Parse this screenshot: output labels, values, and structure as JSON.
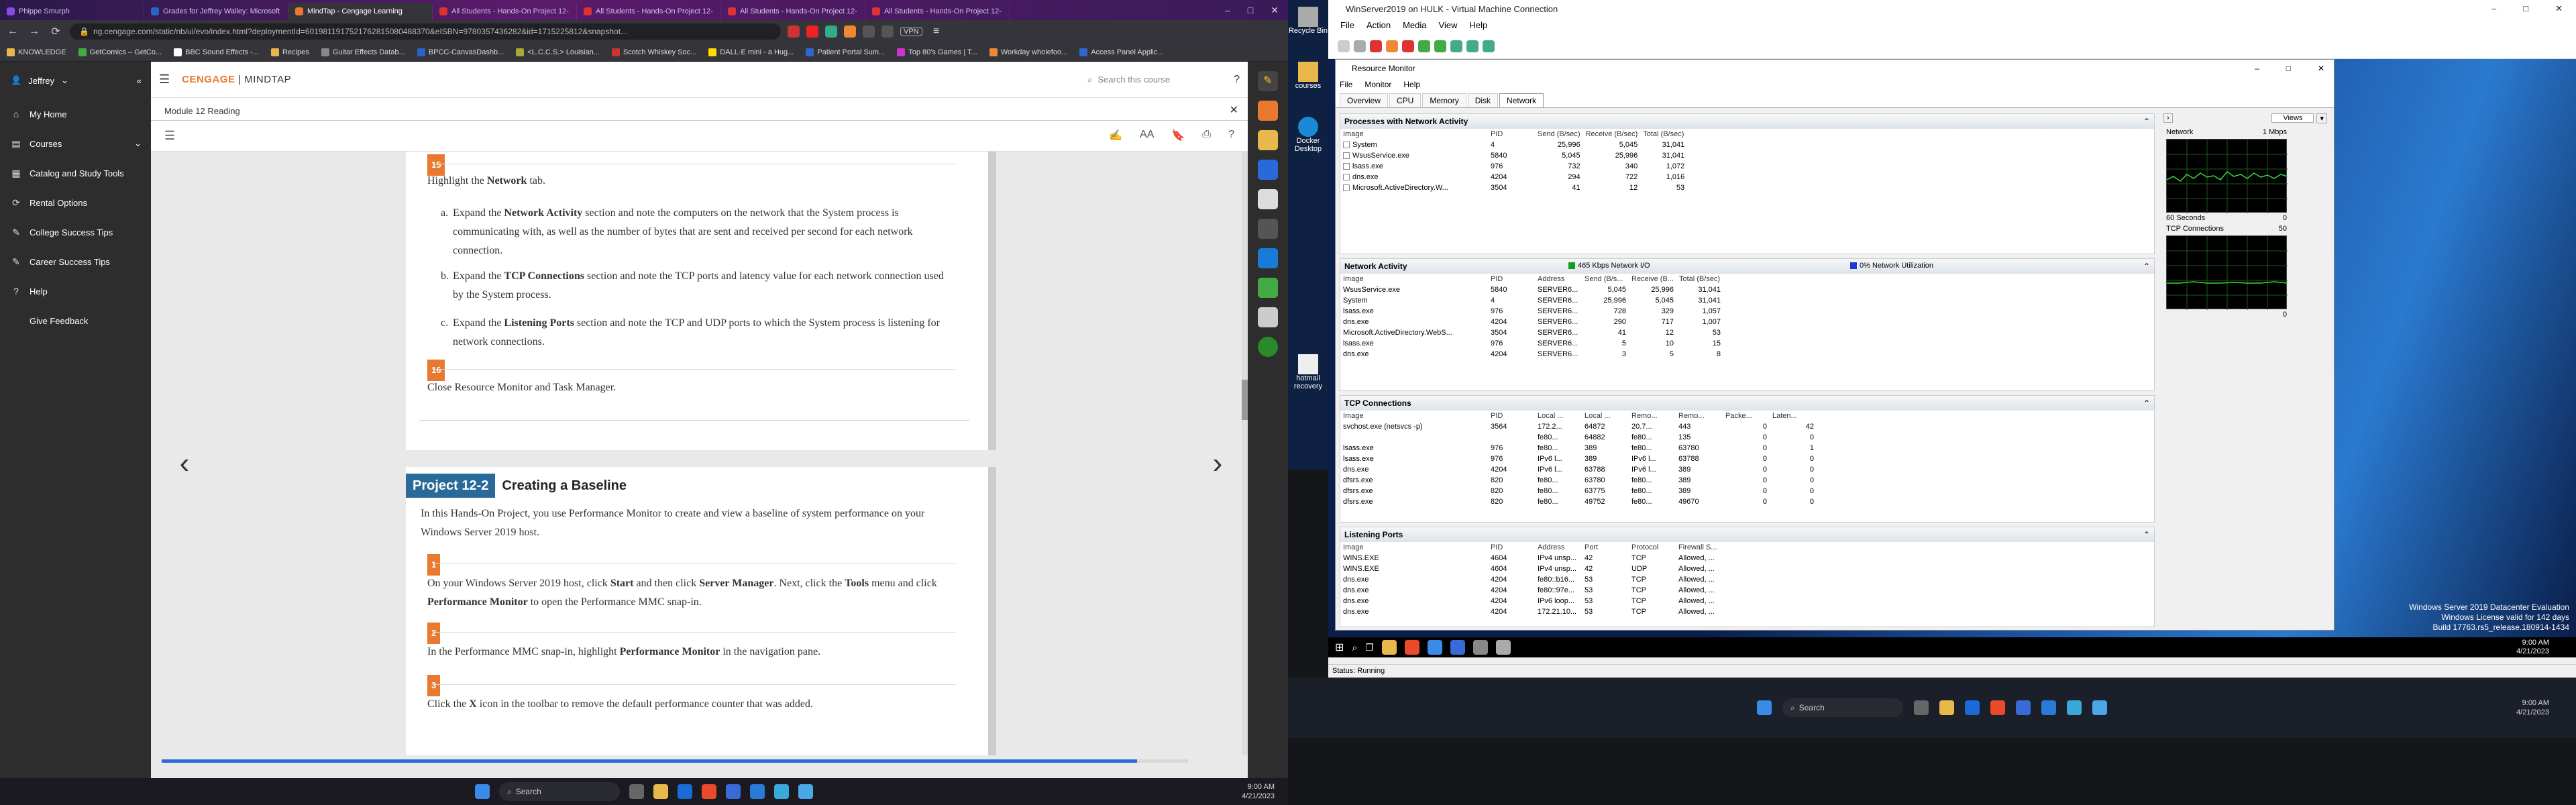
{
  "browser": {
    "tabs": [
      "Phippe Smurph",
      "Grades for Jeffrey Walley: Microsoft",
      "MindTap - Cengage Learning",
      "All Students - Hands-On Project 12-",
      "All Students - Hands-On Project 12-",
      "All Students - Hands-On Project 12-",
      "All Students - Hands-On Project 12-"
    ],
    "url": "ng.cengage.com/static/nb/ui/evo/index.html?deploymentId=6019811917521762815080488370&eISBN=9780357436282&id=1715225812&snapshot...",
    "vpn": "VPN",
    "bookmarks": [
      "KNOWLEDGE",
      "GetComics – GetCo...",
      "BBC Sound Effects -...",
      "Recipes",
      "Guitar Effects Datab...",
      "BPCC-CanvasDashb...",
      "<L.C.C.S.> Louisian...",
      "Scotch Whiskey Soc...",
      "DALL·E mini - a Hug...",
      "Patient Portal Sum...",
      "Top 80's Games | T...",
      "Workday wholefoo...",
      "Access Panel Applic..."
    ]
  },
  "mindtap": {
    "user": "Jeffrey",
    "brand_left": "CENGAGE",
    "brand_right": "MINDTAP",
    "search_placeholder": "Search this course",
    "sidebar": [
      {
        "label": "My Home",
        "icon": "home-icon"
      },
      {
        "label": "Courses",
        "icon": "book-icon"
      },
      {
        "label": "Catalog and Study Tools",
        "icon": "catalog-icon"
      },
      {
        "label": "Rental Options",
        "icon": "rental-icon"
      },
      {
        "label": "College Success Tips",
        "icon": "tips-icon"
      },
      {
        "label": "Career Success Tips",
        "icon": "career-icon"
      },
      {
        "label": "Help",
        "icon": "help-icon"
      },
      {
        "label": "Give Feedback",
        "icon": "feedback-icon"
      }
    ],
    "module_title": "Module 12 Reading",
    "aa": "AA"
  },
  "reading": {
    "step15": "15",
    "highlight_pre": "Highlight the ",
    "highlight_bold": "Network",
    "highlight_post": " tab.",
    "a_pre": "Expand the ",
    "a_bold": "Network Activity",
    "a_post": " section and note the computers on the network that the System process is communicating with, as well as the number of bytes that are sent and received per second for each network connection.",
    "b_pre": "Expand the ",
    "b_bold": "TCP Connections",
    "b_post": " section and note the TCP ports and latency value for each network connection used by the System process.",
    "c_pre": "Expand the ",
    "c_bold": "Listening Ports",
    "c_post": " section and note the TCP and UDP ports to which the System process is listening for network connections.",
    "step16": "16",
    "close_text": "Close Resource Monitor and Task Manager.",
    "project_tag": "Project 12-2",
    "project_title": "Creating a Baseline",
    "project_intro": "In this Hands-On Project, you use Performance Monitor to create and view a baseline of system performance on your Windows Server 2019 host.",
    "s1": "1",
    "s1_text_1": "On your Windows Server 2019 host, click ",
    "s1_b1": "Start",
    "s1_text_2": " and then click ",
    "s1_b2": "Server Manager",
    "s1_text_3": ". Next, click the ",
    "s1_b3": "Tools",
    "s1_text_4": " menu and click ",
    "s1_b4": "Performance Monitor",
    "s1_text_5": " to open the Performance MMC snap-in.",
    "s2": "2",
    "s2_text_1": "In the Performance MMC snap-in, highlight ",
    "s2_b1": "Performance Monitor",
    "s2_text_2": " in the navigation pane.",
    "s3": "3",
    "s3_text_1": "Click the ",
    "s3_b1": "X",
    "s3_text_2": " icon in the toolbar to remove the default performance counter that was added."
  },
  "taskbar_left": {
    "search": "Search",
    "time": "9:00 AM",
    "date": "4/21/2023"
  },
  "vm": {
    "title": "WinServer2019 on HULK - Virtual Machine Connection",
    "menu": [
      "File",
      "Action",
      "Media",
      "View",
      "Help"
    ],
    "status": "Status: Running",
    "desktop_icons": [
      "Recycle Bin",
      "courses",
      "Docker Desktop",
      "hotmail recovery"
    ]
  },
  "resmon": {
    "title": "Resource Monitor",
    "menu": [
      "File",
      "Monitor",
      "Help"
    ],
    "tabs": [
      "Overview",
      "CPU",
      "Memory",
      "Disk",
      "Network"
    ],
    "proc_head": "Processes with Network Activity",
    "proc_cols": [
      "Image",
      "PID",
      "Send (B/sec)",
      "Receive (B/sec)",
      "Total (B/sec)"
    ],
    "proc_rows": [
      [
        "System",
        "4",
        "25,996",
        "5,045",
        "31,041"
      ],
      [
        "WsusService.exe",
        "5840",
        "5,045",
        "25,996",
        "31,041"
      ],
      [
        "lsass.exe",
        "976",
        "732",
        "340",
        "1,072"
      ],
      [
        "dns.exe",
        "4204",
        "294",
        "722",
        "1,016"
      ],
      [
        "Microsoft.ActiveDirectory.W...",
        "3504",
        "41",
        "12",
        "53"
      ]
    ],
    "na_head": "Network Activity",
    "na_legend1": "465 Kbps Network I/O",
    "na_legend2": "0% Network Utilization",
    "na_cols": [
      "Image",
      "PID",
      "Address",
      "Send (B/s...",
      "Receive (B...",
      "Total (B/sec)"
    ],
    "na_rows": [
      [
        "WsusService.exe",
        "5840",
        "SERVER6...",
        "5,045",
        "25,996",
        "31,041"
      ],
      [
        "System",
        "4",
        "SERVER6...",
        "25,996",
        "5,045",
        "31,041"
      ],
      [
        "lsass.exe",
        "976",
        "SERVER6...",
        "728",
        "329",
        "1,057"
      ],
      [
        "dns.exe",
        "4204",
        "SERVER6...",
        "290",
        "717",
        "1,007"
      ],
      [
        "Microsoft.ActiveDirectory.WebS...",
        "3504",
        "SERVER6...",
        "41",
        "12",
        "53"
      ],
      [
        "lsass.exe",
        "976",
        "SERVER6...",
        "5",
        "10",
        "15"
      ],
      [
        "dns.exe",
        "4204",
        "SERVER6...",
        "3",
        "5",
        "8"
      ]
    ],
    "tcp_head": "TCP Connections",
    "tcp_cols": [
      "Image",
      "PID",
      "Local ...",
      "Local ...",
      "Remo...",
      "Remo...",
      "Packe...",
      "Laten..."
    ],
    "tcp_rows": [
      [
        "svchost.exe (netsvcs -p)",
        "3564",
        "172.2...",
        "64872",
        "20.7...",
        "443",
        "0",
        "42"
      ],
      [
        "",
        "",
        "fe80...",
        "64882",
        "fe80...",
        "135",
        "0",
        "0"
      ],
      [
        "lsass.exe",
        "976",
        "fe80...",
        "389",
        "fe80...",
        "63780",
        "0",
        "1"
      ],
      [
        "lsass.exe",
        "976",
        "IPv6 l...",
        "389",
        "IPv6 l...",
        "63788",
        "0",
        "0"
      ],
      [
        "dns.exe",
        "4204",
        "IPv6 l...",
        "63788",
        "IPv6 l...",
        "389",
        "0",
        "0"
      ],
      [
        "dfsrs.exe",
        "820",
        "fe80...",
        "63780",
        "fe80...",
        "389",
        "0",
        "0"
      ],
      [
        "dfsrs.exe",
        "820",
        "fe80...",
        "63775",
        "fe80...",
        "389",
        "0",
        "0"
      ],
      [
        "dfsrs.exe",
        "820",
        "fe80...",
        "49752",
        "fe80...",
        "49670",
        "0",
        "0"
      ]
    ],
    "lp_head": "Listening Ports",
    "lp_cols": [
      "Image",
      "PID",
      "Address",
      "Port",
      "Protocol",
      "Firewall S..."
    ],
    "lp_rows": [
      [
        "WINS.EXE",
        "4604",
        "IPv4 unsp...",
        "42",
        "TCP",
        "Allowed, ..."
      ],
      [
        "WINS.EXE",
        "4604",
        "IPv4 unsp...",
        "42",
        "UDP",
        "Allowed, ..."
      ],
      [
        "dns.exe",
        "4204",
        "fe80::b16...",
        "53",
        "TCP",
        "Allowed, ..."
      ],
      [
        "dns.exe",
        "4204",
        "fe80::97e...",
        "53",
        "TCP",
        "Allowed, ..."
      ],
      [
        "dns.exe",
        "4204",
        "IPv6 loop...",
        "53",
        "TCP",
        "Allowed, ..."
      ],
      [
        "dns.exe",
        "4204",
        "172.21.10...",
        "53",
        "TCP",
        "Allowed, ..."
      ]
    ],
    "views": "Views",
    "g1_title": "Network",
    "g1_max": "1 Mbps",
    "g1_foot_l": "60 Seconds",
    "g1_foot_r": "0",
    "g2_title": "TCP Connections",
    "g2_max": "50",
    "g2_foot_r": "0"
  },
  "guest_notice": {
    "l1": "Windows Server 2019 Datacenter Evaluation",
    "l2": "Windows License valid for 142 days",
    "l3": "Build 17763.rs5_release.180914-1434"
  },
  "guest_clock": {
    "time": "9:00 AM",
    "date": "4/21/2023"
  },
  "host_right": {
    "search": "Search",
    "time": "9:00 AM",
    "date": "4/21/2023"
  }
}
